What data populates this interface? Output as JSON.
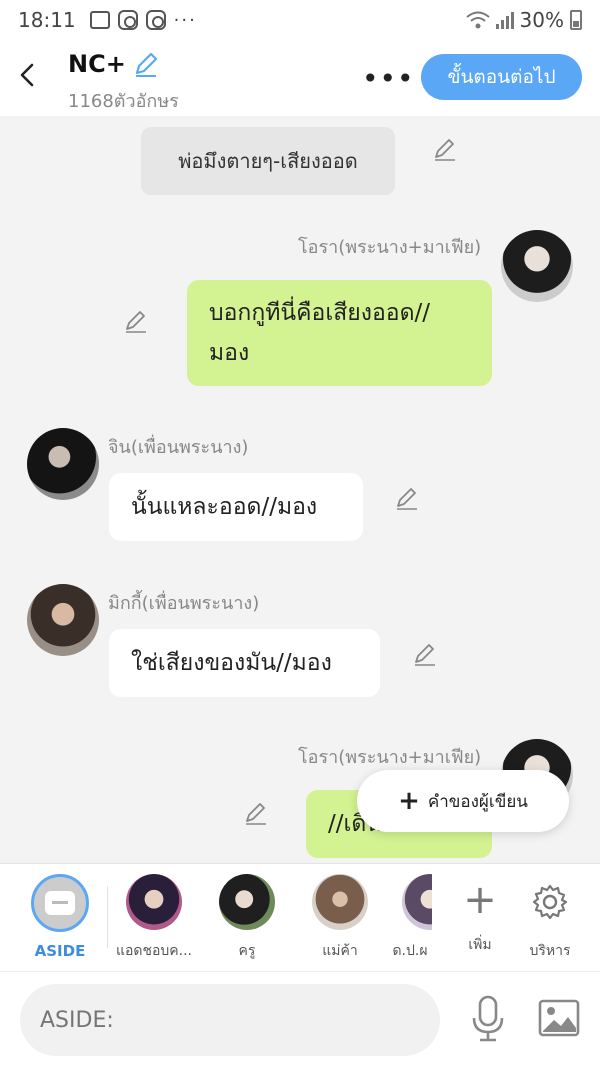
{
  "status_bar": {
    "time": "18:11",
    "overflow": "···",
    "battery": "30%"
  },
  "header": {
    "title": "NC+",
    "char_count": "1168ตัวอักษร",
    "next_button": "ขั้นตอนต่อไป",
    "more": "•••"
  },
  "messages": [
    {
      "type": "system",
      "text": "พ่อมึงตายๆ-เสียงออด"
    },
    {
      "type": "me",
      "name": "โอรา(พระนาง+มาเฟีย)",
      "lines": [
        "บอกกูทีนี่คือเสียงออด//",
        "มอง"
      ]
    },
    {
      "type": "other",
      "name": "จิน(เพื่อนพระนาง)",
      "text": "นั้นแหละออด//มอง"
    },
    {
      "type": "other",
      "name": "มิกกี้(เพื่อนพระนาง)",
      "text": "ใช่เสียงของมัน//มอง"
    },
    {
      "type": "me",
      "name": "โอรา(พระนาง+มาเฟีย)",
      "text": "//เดินออกไป"
    }
  ],
  "fab": {
    "label": "คำของผู้เขียน",
    "icon": "+"
  },
  "characters": [
    {
      "label": "ASIDE",
      "active": true
    },
    {
      "label": "แอดชอบค..."
    },
    {
      "label": "ครู"
    },
    {
      "label": "แม่ค้า"
    },
    {
      "label": "ด.ป.ผ"
    }
  ],
  "tools": {
    "add": "เพิ่ม",
    "manage": "บริหาร"
  },
  "input": {
    "placeholder": "ASIDE:"
  },
  "colors": {
    "accent": "#5aa8f5",
    "my_bubble": "#d3f291",
    "other_bubble": "#ffffff",
    "system_bubble": "#e6e6e6"
  }
}
